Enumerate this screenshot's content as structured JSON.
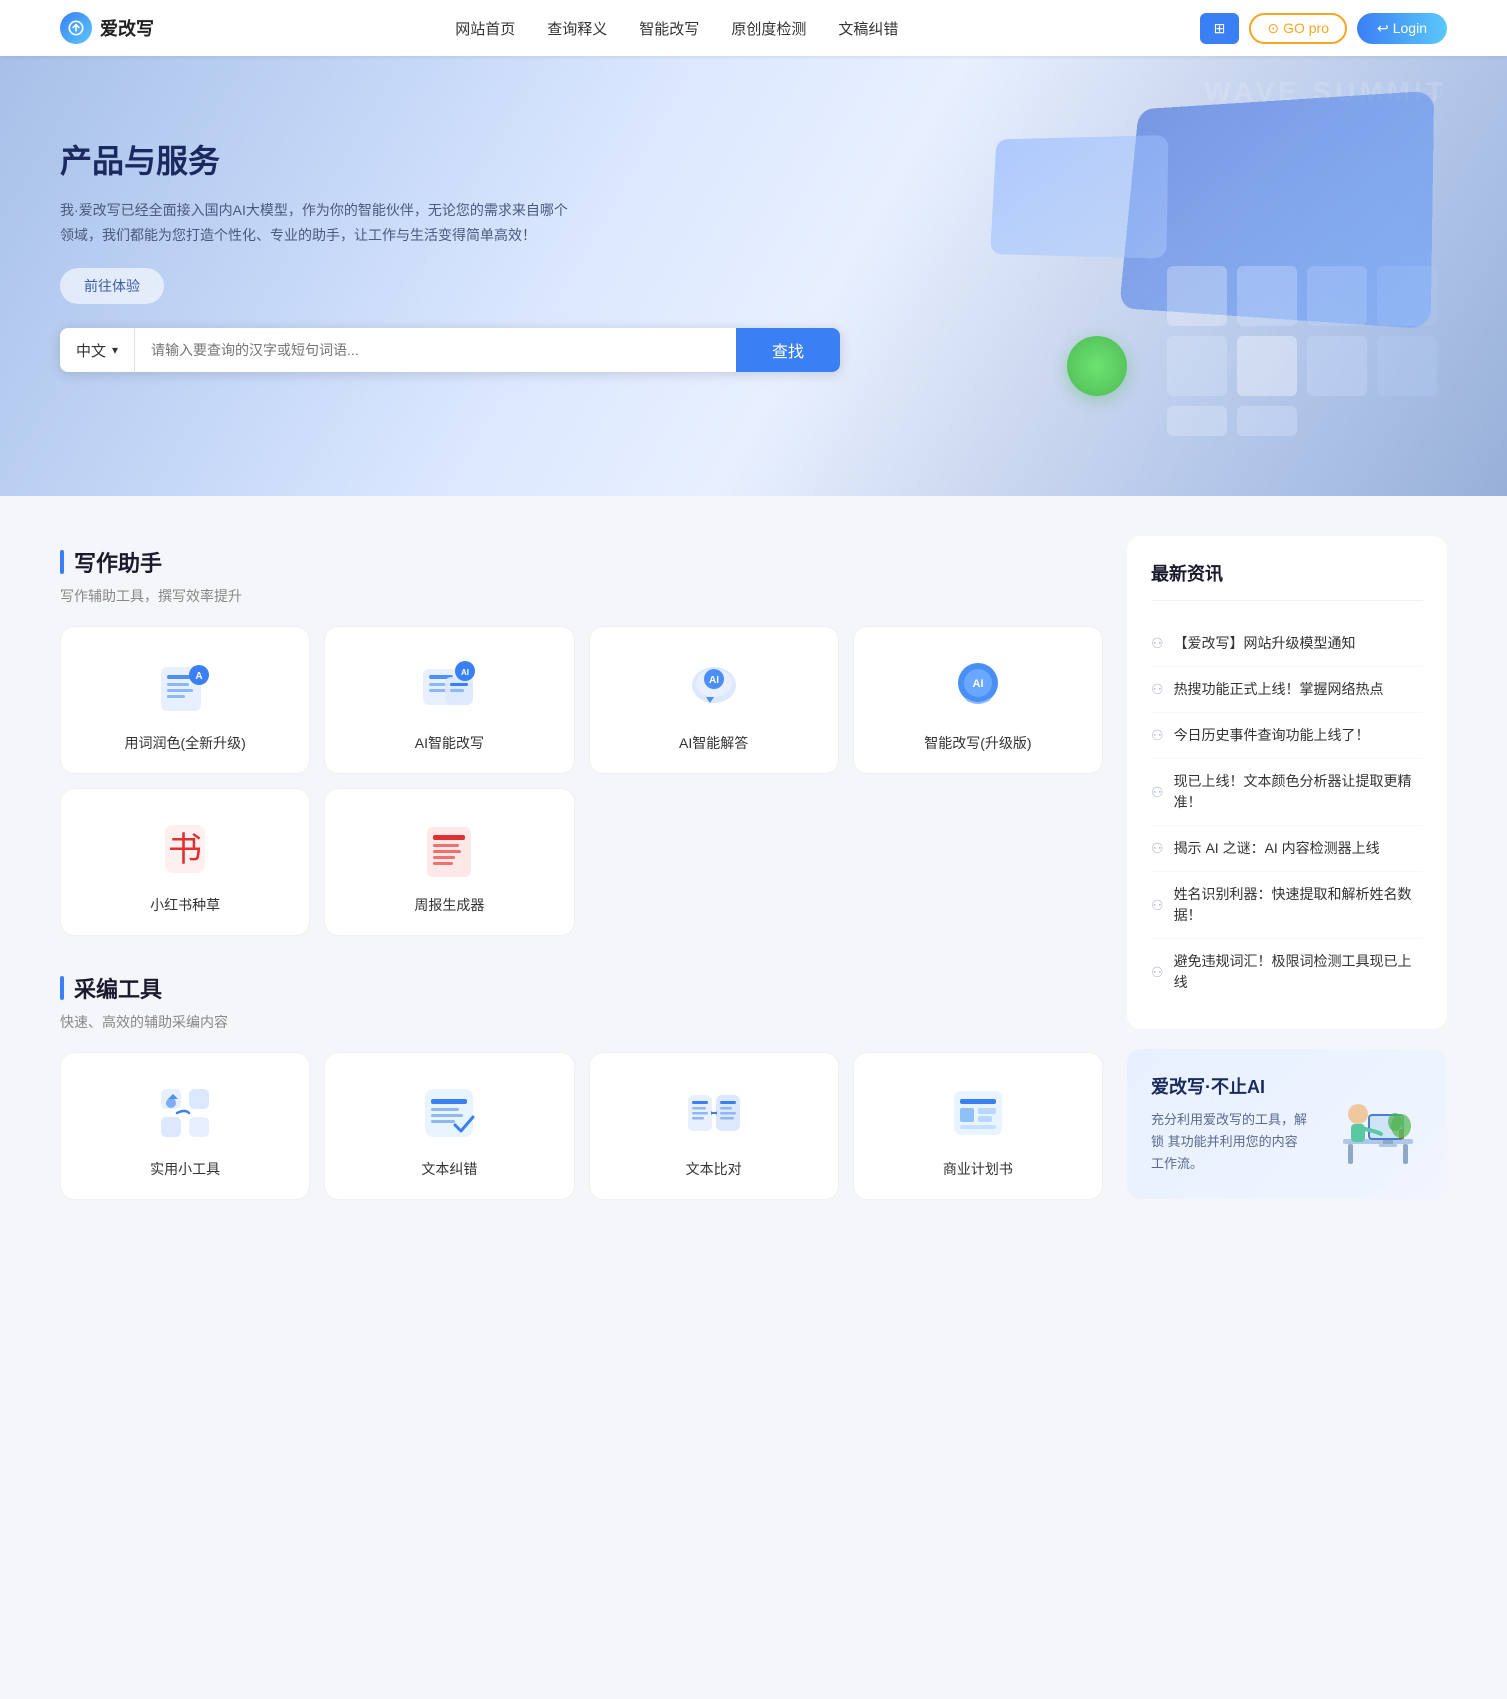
{
  "header": {
    "logo_text": "爱改写",
    "nav_items": [
      "网站首页",
      "查询释义",
      "智能改写",
      "原创度检测",
      "文稿纠错"
    ],
    "btn_apps_label": "⊞",
    "btn_go_label": "GO pro",
    "btn_login_label": "Login"
  },
  "hero": {
    "title": "产品与服务",
    "desc": "我·爱改写已经全面接入国内AI大模型，作为你的智能伙伴，无论您的需求来自哪个领域，我们都能为您打造个性化、专业的助手，让工作与生活变得简单高效！",
    "btn_label": "前往体验",
    "wave_text": "WAVE SUMMIT"
  },
  "search": {
    "lang": "中文",
    "placeholder": "请输入要查询的汉字或短句词语...",
    "btn_label": "查找"
  },
  "writing_section": {
    "title": "写作助手",
    "subtitle": "写作辅助工具，撰写效率提升",
    "tools": [
      {
        "id": "writing-color",
        "label": "用词润色(全新升级)"
      },
      {
        "id": "ai-rewrite",
        "label": "AI智能改写"
      },
      {
        "id": "ai-answer",
        "label": "AI智能解答"
      },
      {
        "id": "smart-rewrite-pro",
        "label": "智能改写(升级版)"
      },
      {
        "id": "xiaohongshu",
        "label": "小红书种草"
      },
      {
        "id": "weekly-report",
        "label": "周报生成器"
      }
    ]
  },
  "caijian_section": {
    "title": "采编工具",
    "subtitle": "快速、高效的辅助采编内容",
    "tools": [
      {
        "id": "utils",
        "label": "实用小工具"
      },
      {
        "id": "text-proofread",
        "label": "文本纠错"
      },
      {
        "id": "text-compare",
        "label": "文本比对"
      },
      {
        "id": "business-plan",
        "label": "商业计划书"
      }
    ]
  },
  "news": {
    "title": "最新资讯",
    "items": [
      "【爱改写】网站升级模型通知",
      "热搜功能正式上线！掌握网络热点",
      "今日历史事件查询功能上线了！",
      "现已上线！文本颜色分析器让提取更精准！",
      "揭示 AI 之谜：AI 内容检测器上线",
      "姓名识别利器：快速提取和解析姓名数据！",
      "避免违规词汇！极限词检测工具现已上线"
    ]
  },
  "promo": {
    "title": "爱改写·不止AI",
    "desc": "充分利用爱改写的工具，解锁\n其功能并利用您的内容工作流。"
  }
}
